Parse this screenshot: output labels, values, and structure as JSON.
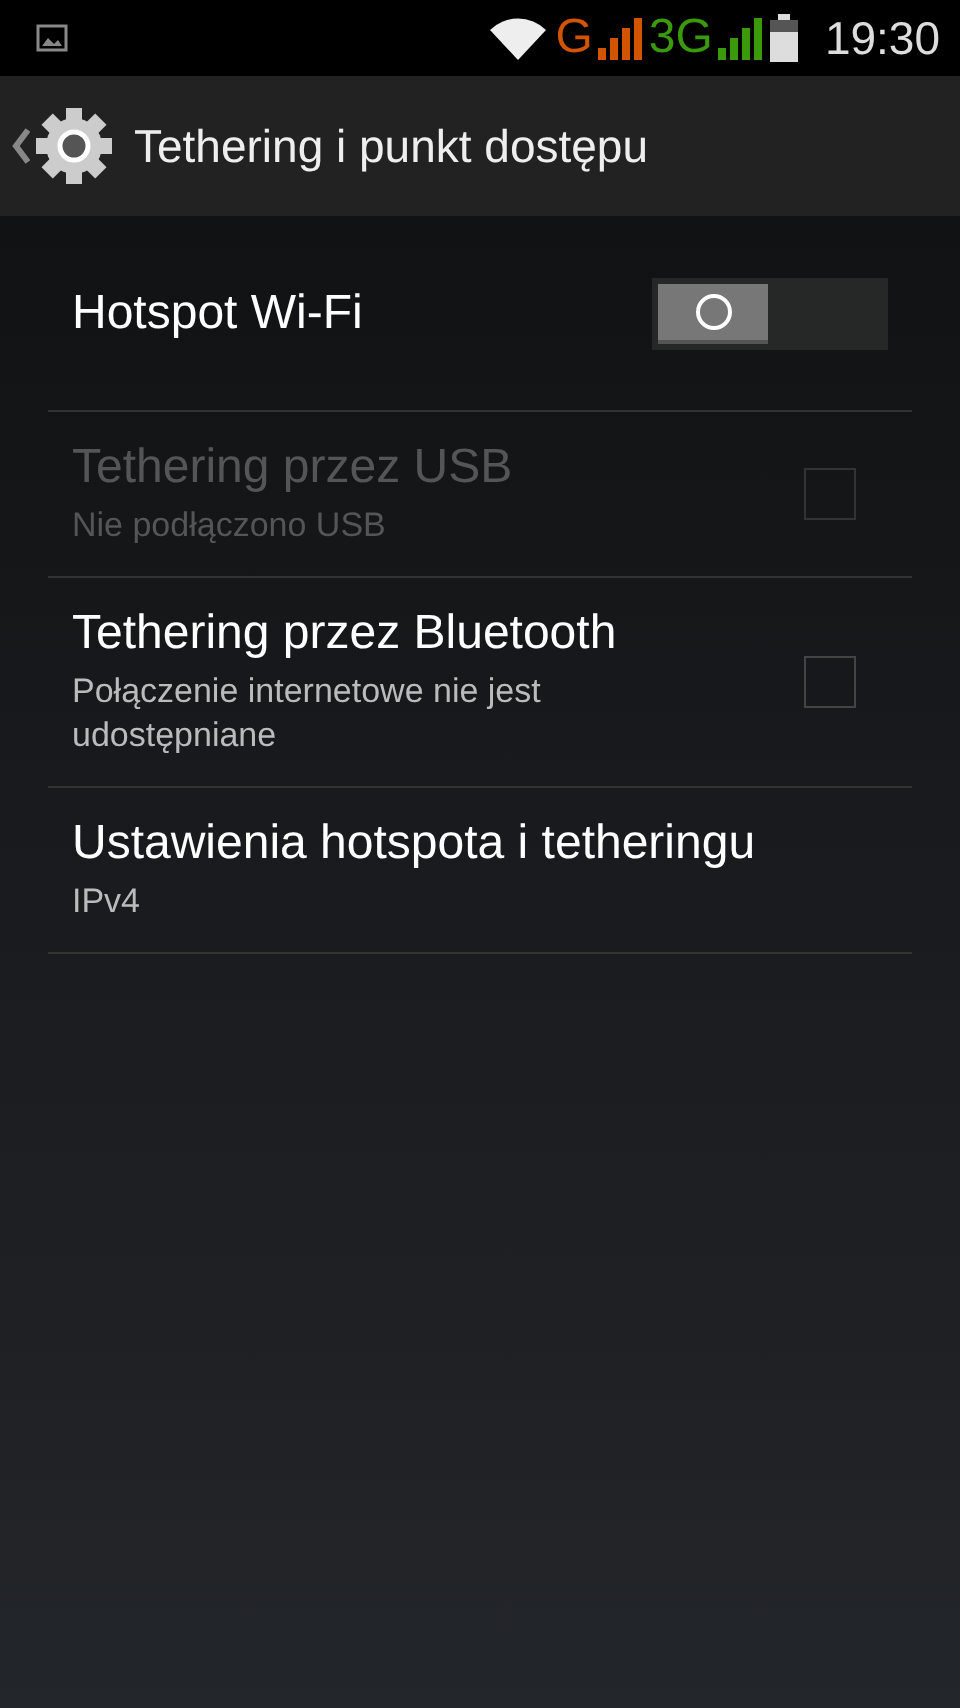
{
  "status_bar": {
    "network_1": "G",
    "network_2": "3G",
    "time": "19:30"
  },
  "action_bar": {
    "title": "Tethering i punkt dostępu"
  },
  "items": [
    {
      "kind": "switch",
      "title": "Hotspot Wi-Fi",
      "on": false,
      "disabled": false
    },
    {
      "kind": "checkbox",
      "title": "Tethering przez USB",
      "summary": "Nie podłączono USB",
      "checked": false,
      "disabled": true
    },
    {
      "kind": "checkbox",
      "title": "Tethering przez Bluetooth",
      "summary": "Połączenie internetowe nie jest udostępniane",
      "checked": false,
      "disabled": false
    },
    {
      "kind": "plain",
      "title": "Ustawienia hotspota i tetheringu",
      "summary": "IPv4",
      "disabled": false
    }
  ]
}
